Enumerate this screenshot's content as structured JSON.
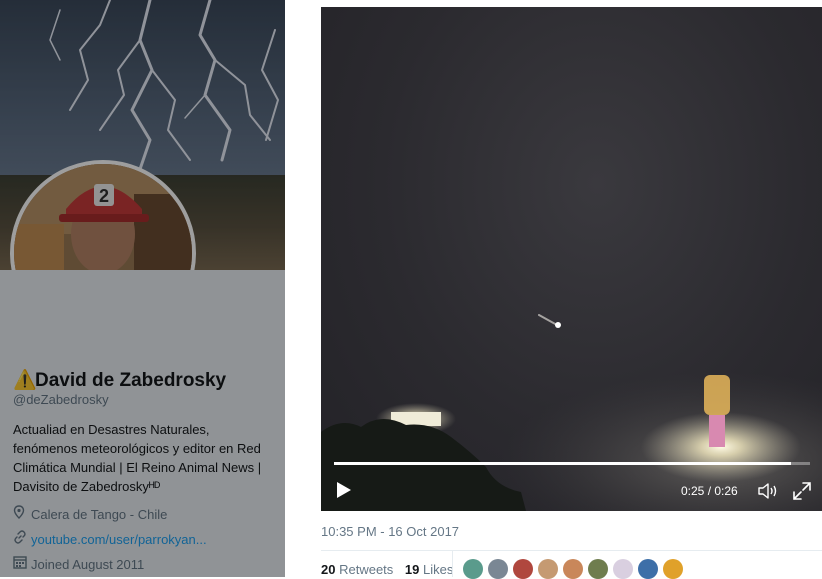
{
  "profile": {
    "name": "David de Zabedrosky",
    "warning_icon": "⚠️",
    "handle": "@deZabedrosky",
    "bio": "Actualiad en Desastres Naturales, fenómenos meteorológicos y editor en Red Climática Mundial | El Reino Animal News | Davisito de Zabedroskyᴴᴰ",
    "location": "Calera de Tango - Chile",
    "website": "youtube.com/user/parrokyan...",
    "joined": "Joined August 2011",
    "banner_icon": "lightning-banner",
    "avatar_icon": "firefighter-avatar",
    "helmet_number": "2"
  },
  "video": {
    "current_time": "0:25",
    "duration": "0:26",
    "time_label": "0:25 / 0:26",
    "progress_fraction": 0.96,
    "play_icon": "play-icon",
    "volume_icon": "volume-icon",
    "fullscreen_icon": "fullscreen-icon"
  },
  "tweet": {
    "timestamp": "10:35 PM - 16 Oct 2017",
    "retweets_count": "20",
    "retweets_label": "Retweets",
    "likes_count": "19",
    "likes_label": "Likes"
  },
  "likers": [
    {
      "color": "#5a9b8c"
    },
    {
      "color": "#7a8794"
    },
    {
      "color": "#b0473e"
    },
    {
      "color": "#c59a72"
    },
    {
      "color": "#c9875a"
    },
    {
      "color": "#6f7d4e"
    },
    {
      "color": "#d9cfe0"
    },
    {
      "color": "#3d6fa8"
    },
    {
      "color": "#e0a12a"
    }
  ]
}
